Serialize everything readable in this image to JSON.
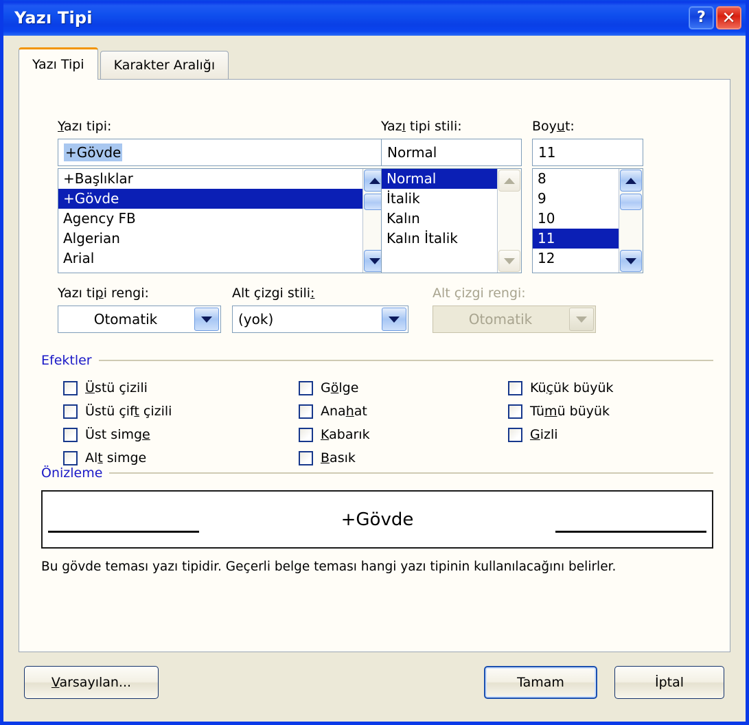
{
  "window": {
    "title": "Yazı Tipi",
    "help_button": "?",
    "close_button": "✕"
  },
  "tabs": [
    {
      "label": "Yazı Tipi",
      "active": true
    },
    {
      "label": "Karakter Aralığı",
      "active": false
    }
  ],
  "font_section": {
    "font_label": "Yazı tipi:",
    "font_value": "+Gövde",
    "font_items": [
      "+Başlıklar",
      "+Gövde",
      "Agency FB",
      "Algerian",
      "Arial"
    ],
    "font_selected": "+Gövde",
    "style_label": "Yazı tipi stili:",
    "style_value": "Normal",
    "style_items": [
      "Normal",
      "İtalik",
      "Kalın",
      "Kalın İtalik"
    ],
    "style_selected": "Normal",
    "size_label": "Boyut:",
    "size_value": "11",
    "size_items": [
      "8",
      "9",
      "10",
      "11",
      "12"
    ],
    "size_selected": "11"
  },
  "color_section": {
    "font_color_label": "Yazı tipi rengi:",
    "font_color_value": "Otomatik",
    "underline_style_label": "Alt çizgi stili:",
    "underline_style_value": "(yok)",
    "underline_color_label": "Alt çizgi rengi:",
    "underline_color_value": "Otomatik",
    "underline_color_disabled": true
  },
  "effects": {
    "group_title": "Efektler",
    "column1": [
      "Üstü çizili",
      "Üstü çift çizili",
      "Üst simge",
      "Alt simge"
    ],
    "column2": [
      "Gölge",
      "Anahat",
      "Kabarık",
      "Basık"
    ],
    "column3": [
      "Küçük büyük",
      "Tümü büyük",
      "Gizli"
    ]
  },
  "preview": {
    "group_title": "Önizleme",
    "sample_text": "+Gövde",
    "description": "Bu gövde teması yazı tipidir. Geçerli belge teması hangi yazı tipinin kullanılacağını belirler."
  },
  "buttons": {
    "default": "Varsayılan...",
    "ok": "Tamam",
    "cancel": "İptal"
  },
  "colors": {
    "titlebar": "#0a3ae8",
    "dialog_face": "#ece9d8",
    "panel_face": "#fffdf7",
    "group_label": "#1a19c7",
    "selection": "#0b1fb5",
    "tab_accent": "#f29400"
  }
}
